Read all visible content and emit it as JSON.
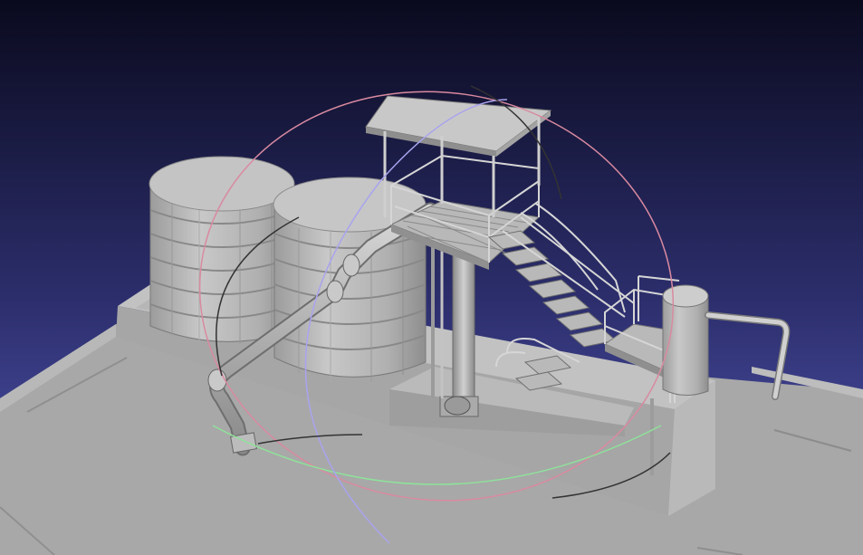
{
  "viewer": {
    "background_top": "#0a0a1e",
    "background_bottom": "#545ab5",
    "model_fill": "#b4b4b4",
    "model_edge": "#555555",
    "trackball_red": "#d98aa0",
    "trackball_green": "#8ee29a",
    "trackball_blue": "#a9a4ee",
    "trackball_dark": "#333333"
  }
}
